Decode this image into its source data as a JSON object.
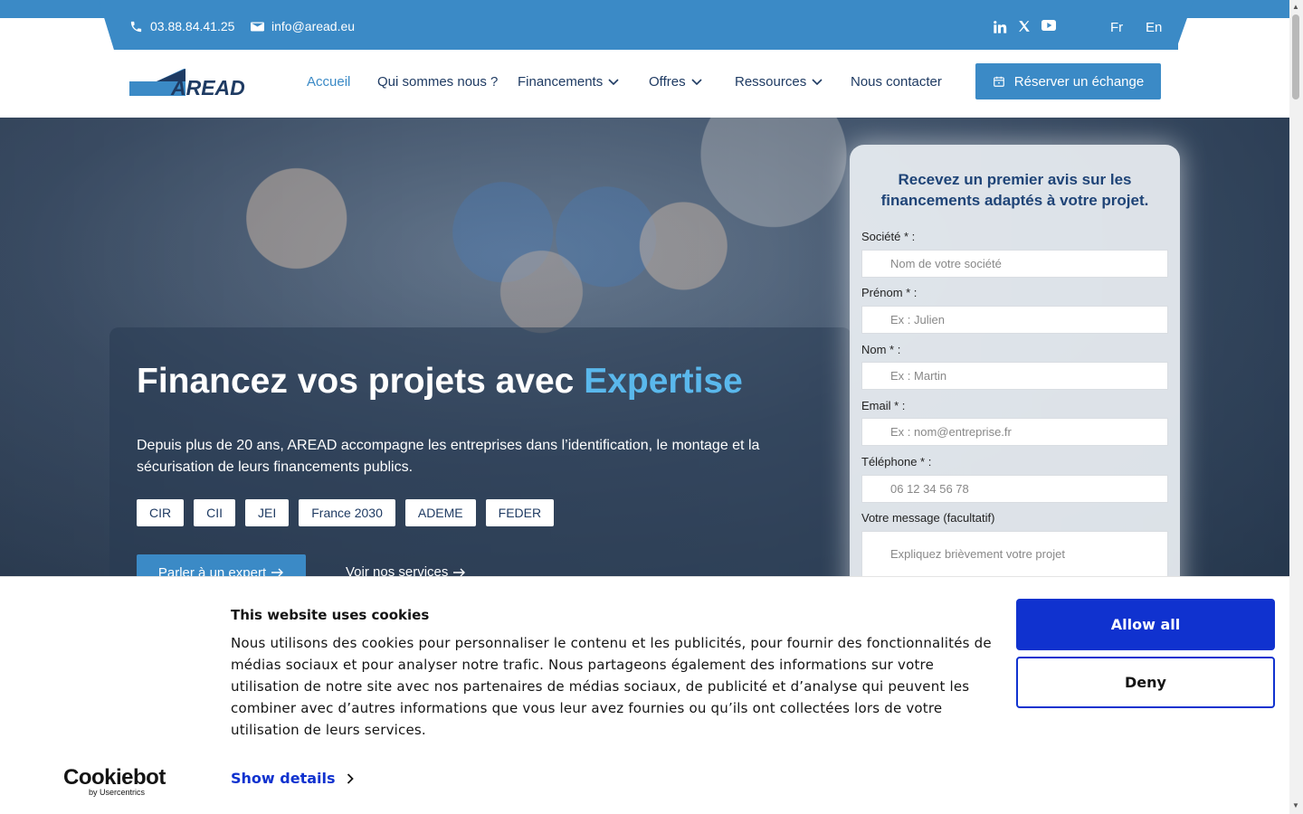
{
  "topbar": {
    "phone": "03.88.84.41.25",
    "email": "info@aread.eu",
    "social_icons": [
      "linkedin-icon",
      "x-icon",
      "youtube-icon"
    ],
    "languages": [
      "Fr",
      "En"
    ]
  },
  "header": {
    "logo_text": "AREAD",
    "nav": [
      {
        "label": "Accueil",
        "active": true,
        "dropdown": false
      },
      {
        "label": "Qui sommes nous ?",
        "active": false,
        "dropdown": false
      },
      {
        "label": "Financements",
        "active": false,
        "dropdown": true
      },
      {
        "label": "Offres",
        "active": false,
        "dropdown": true
      },
      {
        "label": "Ressources",
        "active": false,
        "dropdown": true
      },
      {
        "label": "Nous contacter",
        "active": false,
        "dropdown": false
      }
    ],
    "cta_label": "Réserver un échange"
  },
  "hero": {
    "title_main": "Financez vos projets avec ",
    "title_accent": "Expertise",
    "subtitle": "Depuis plus de 20 ans, AREAD accompagne les entreprises dans l’identification, le montage et la sécurisation de leurs financements publics.",
    "tags": [
      "CIR",
      "CII",
      "JEI",
      "France 2030",
      "ADEME",
      "FEDER"
    ],
    "primary_button": "Parler à un expert",
    "secondary_link": "Voir nos services"
  },
  "form": {
    "title": "Recevez un premier avis sur les financements adaptés à votre projet.",
    "fields": [
      {
        "label": "Société * :",
        "placeholder": "Nom de votre société"
      },
      {
        "label": "Prénom * :",
        "placeholder": "Ex : Julien"
      },
      {
        "label": "Nom * :",
        "placeholder": "Ex : Martin"
      },
      {
        "label": "Email * :",
        "placeholder": "Ex : nom@entreprise.fr"
      },
      {
        "label": "Téléphone * :",
        "placeholder": "06 12 34 56 78"
      },
      {
        "label": "Votre message (facultatif)",
        "placeholder": "Expliquez brièvement votre projet"
      }
    ]
  },
  "cookie": {
    "title": "This website uses cookies",
    "text": "Nous utilisons des cookies pour personnaliser le contenu et les publicités, pour fournir des fonctionnalités de médias sociaux et pour analyser notre trafic. Nous partageons également des informations sur votre utilisation de notre site avec nos partenaires de médias sociaux, de publicité et d’analyse qui peuvent les combiner avec d’autres informations que vous leur avez fournies ou qu’ils ont collectées lors de votre utilisation de leurs services.",
    "details_label": "Show details",
    "allow_label": "Allow all",
    "deny_label": "Deny",
    "brand": "Cookiebot",
    "brand_sub": "by Usercentrics"
  },
  "colors": {
    "primary": "#3b8ac6",
    "navy": "#1f3b63",
    "accent": "#5ab8ec",
    "cookie_blue": "#1032cf"
  }
}
